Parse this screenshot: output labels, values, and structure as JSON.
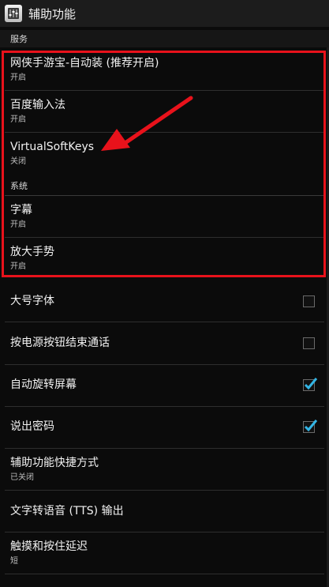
{
  "app": {
    "title": "辅助功能",
    "icon": "equalizer-settings-icon"
  },
  "sections": {
    "services": "服务",
    "system": "系统"
  },
  "services": [
    {
      "label": "网侠手游宝-自动装 (推荐开启)",
      "status": "开启"
    },
    {
      "label": "百度输入法",
      "status": "开启"
    },
    {
      "label": "VirtualSoftKeys",
      "status": "关闭"
    }
  ],
  "system": [
    {
      "label": "字幕",
      "status": "开启"
    },
    {
      "label": "放大手势",
      "status": "开启"
    },
    {
      "label": "大号字体",
      "checked": false
    },
    {
      "label": "按电源按钮结束通话",
      "checked": false
    },
    {
      "label": "自动旋转屏幕",
      "checked": true
    },
    {
      "label": "说出密码",
      "checked": true
    },
    {
      "label": "辅助功能快捷方式",
      "status": "已关闭"
    },
    {
      "label": "文字转语音 (TTS) 输出"
    },
    {
      "label": "触摸和按住延迟",
      "status": "短"
    }
  ],
  "annotation": {
    "highlight_color": "#e8121b",
    "accent_color": "#33b5e5"
  }
}
